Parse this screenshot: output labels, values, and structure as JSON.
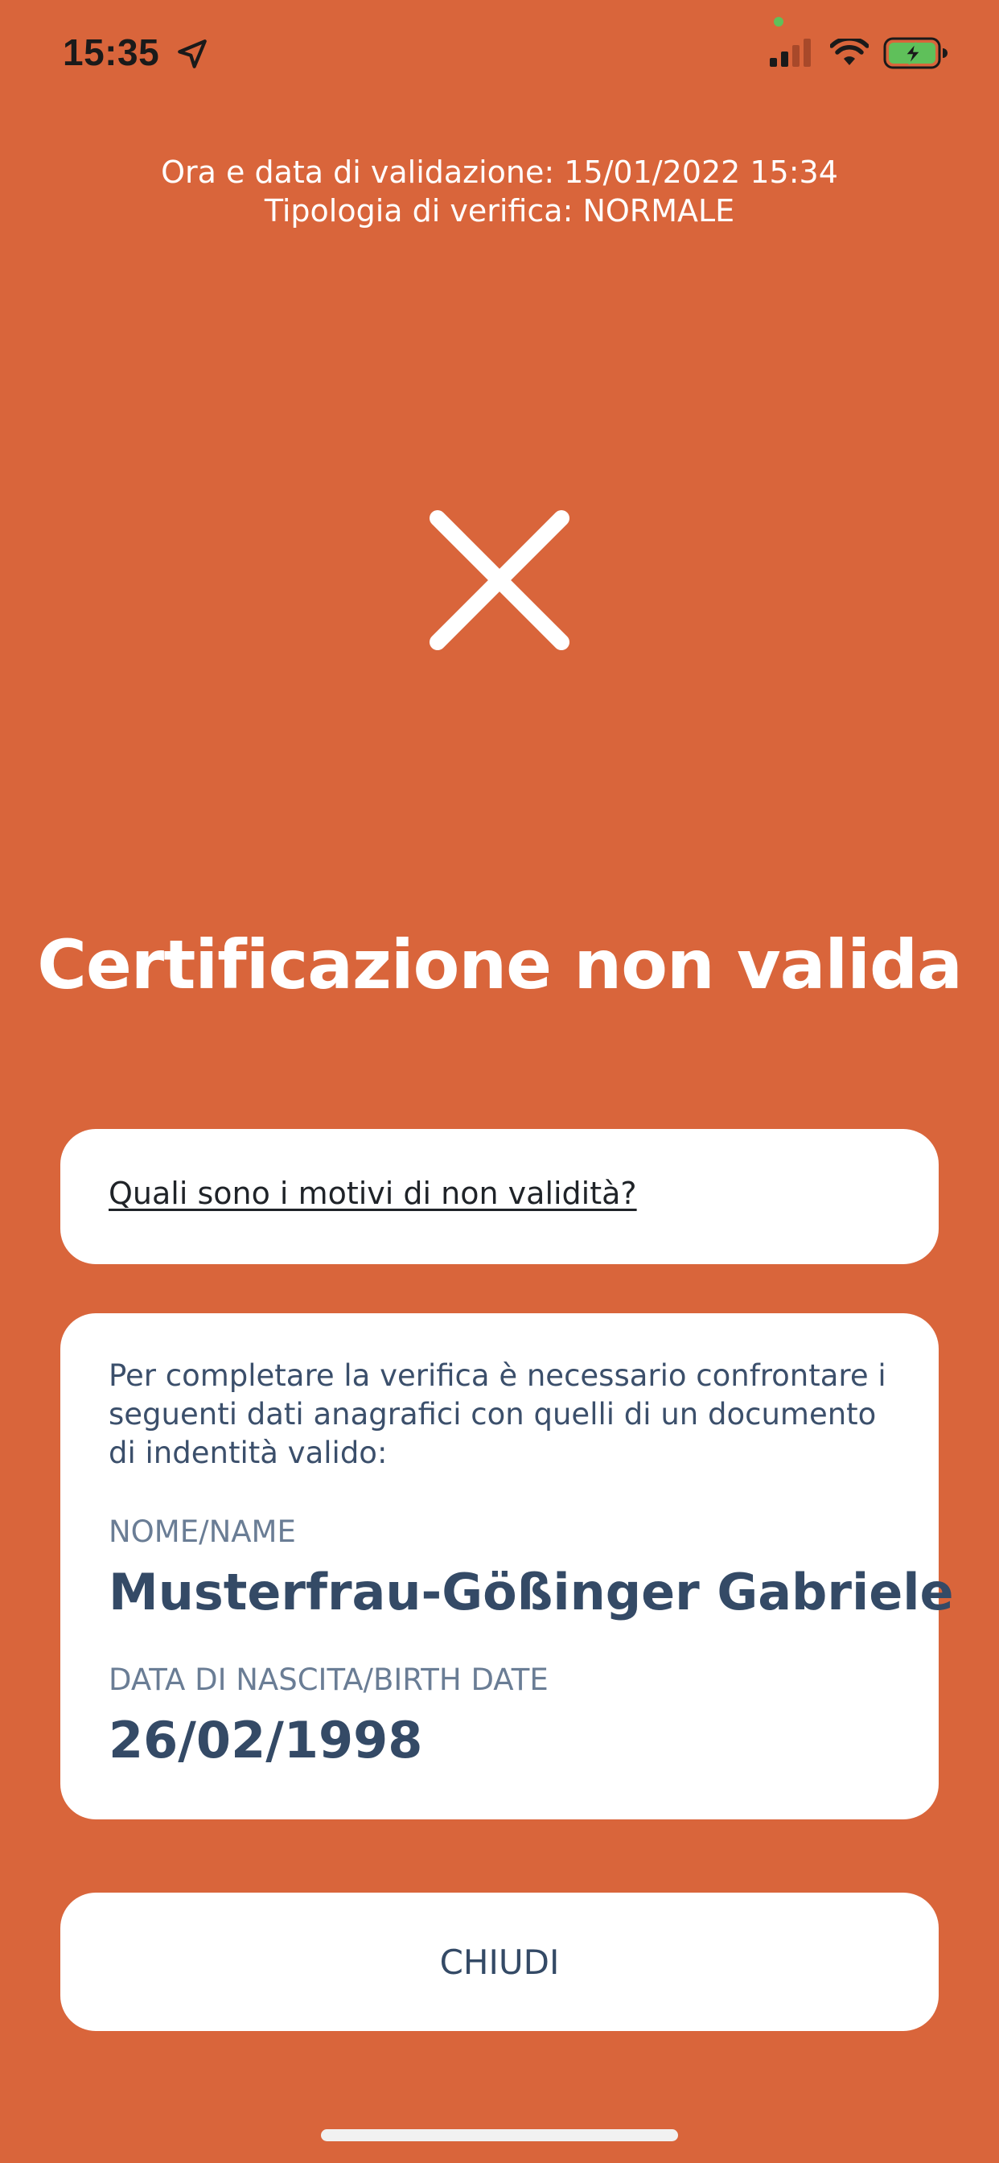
{
  "status_bar": {
    "time": "15:35"
  },
  "validation": {
    "datetime_line": "Ora e data di validazione: 15/01/2022 15:34",
    "type_line": "Tipologia di verifica: NORMALE"
  },
  "result": {
    "title": "Certificazione non valida"
  },
  "reasons": {
    "link_text": "Quali sono i motivi di non validità?"
  },
  "personal_data": {
    "intro": "Per completare la verifica è necessario confrontare i seguenti dati anagrafici con quelli di un documento di indentità valido:",
    "name_label": "NOME/NAME",
    "name_value": "Musterfrau-Gößinger Gabriele",
    "birth_label": "DATA DI NASCITA/BIRTH DATE",
    "birth_value": "26/02/1998"
  },
  "actions": {
    "close_label": "CHIUDI"
  },
  "colors": {
    "background": "#d9653b",
    "card": "#ffffff",
    "text_dark_blue": "#344a66"
  },
  "icons": {
    "location": "location-arrow-icon",
    "signal": "cellular-signal-icon",
    "wifi": "wifi-icon",
    "battery": "battery-charging-icon",
    "result": "close-x-icon"
  }
}
